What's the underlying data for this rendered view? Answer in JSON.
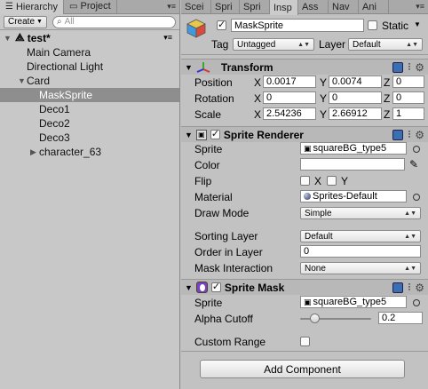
{
  "hierarchy": {
    "tabs": [
      {
        "label": "Hierarchy"
      },
      {
        "label": "Project"
      }
    ],
    "create_label": "Create",
    "search_placeholder": "All",
    "scene_name": "test*",
    "items": [
      {
        "label": "Main Camera"
      },
      {
        "label": "Directional Light"
      },
      {
        "label": "Card"
      },
      {
        "label": "MaskSprite"
      },
      {
        "label": "Deco1"
      },
      {
        "label": "Deco2"
      },
      {
        "label": "Deco3"
      },
      {
        "label": "character_63"
      }
    ]
  },
  "inspector": {
    "tabs": [
      {
        "label": "Scei"
      },
      {
        "label": "Spri"
      },
      {
        "label": "Spri"
      },
      {
        "label": "Insp"
      },
      {
        "label": "Ass"
      },
      {
        "label": "Nav"
      },
      {
        "label": "Ani"
      }
    ],
    "object_name": "MaskSprite",
    "static_label": "Static",
    "tag_label": "Tag",
    "tag_value": "Untagged",
    "layer_label": "Layer",
    "layer_value": "Default",
    "transform": {
      "title": "Transform",
      "position_label": "Position",
      "rotation_label": "Rotation",
      "scale_label": "Scale",
      "position": {
        "x": "0.0017",
        "y": "0.0074",
        "z": "0"
      },
      "rotation": {
        "x": "0",
        "y": "0",
        "z": "0"
      },
      "scale": {
        "x": "2.54236",
        "y": "2.66912",
        "z": "1"
      }
    },
    "sprite_renderer": {
      "title": "Sprite Renderer",
      "sprite_label": "Sprite",
      "sprite_value": "squareBG_type5",
      "color_label": "Color",
      "flip_label": "Flip",
      "flip_x_label": "X",
      "flip_y_label": "Y",
      "material_label": "Material",
      "material_value": "Sprites-Default",
      "draw_mode_label": "Draw Mode",
      "draw_mode_value": "Simple",
      "sorting_layer_label": "Sorting Layer",
      "sorting_layer_value": "Default",
      "order_label": "Order in Layer",
      "order_value": "0",
      "mask_interaction_label": "Mask Interaction",
      "mask_interaction_value": "None"
    },
    "sprite_mask": {
      "title": "Sprite Mask",
      "sprite_label": "Sprite",
      "sprite_value": "squareBG_type5",
      "alpha_label": "Alpha Cutoff",
      "alpha_value": "0.2",
      "alpha_fraction": 0.2,
      "custom_range_label": "Custom Range"
    },
    "add_component_label": "Add Component",
    "axis_labels": {
      "x": "X",
      "y": "Y",
      "z": "Z"
    }
  },
  "colors": {
    "selection": "#8e8e8e",
    "header": "#b8b8b8",
    "panel": "#c2c2c2"
  }
}
